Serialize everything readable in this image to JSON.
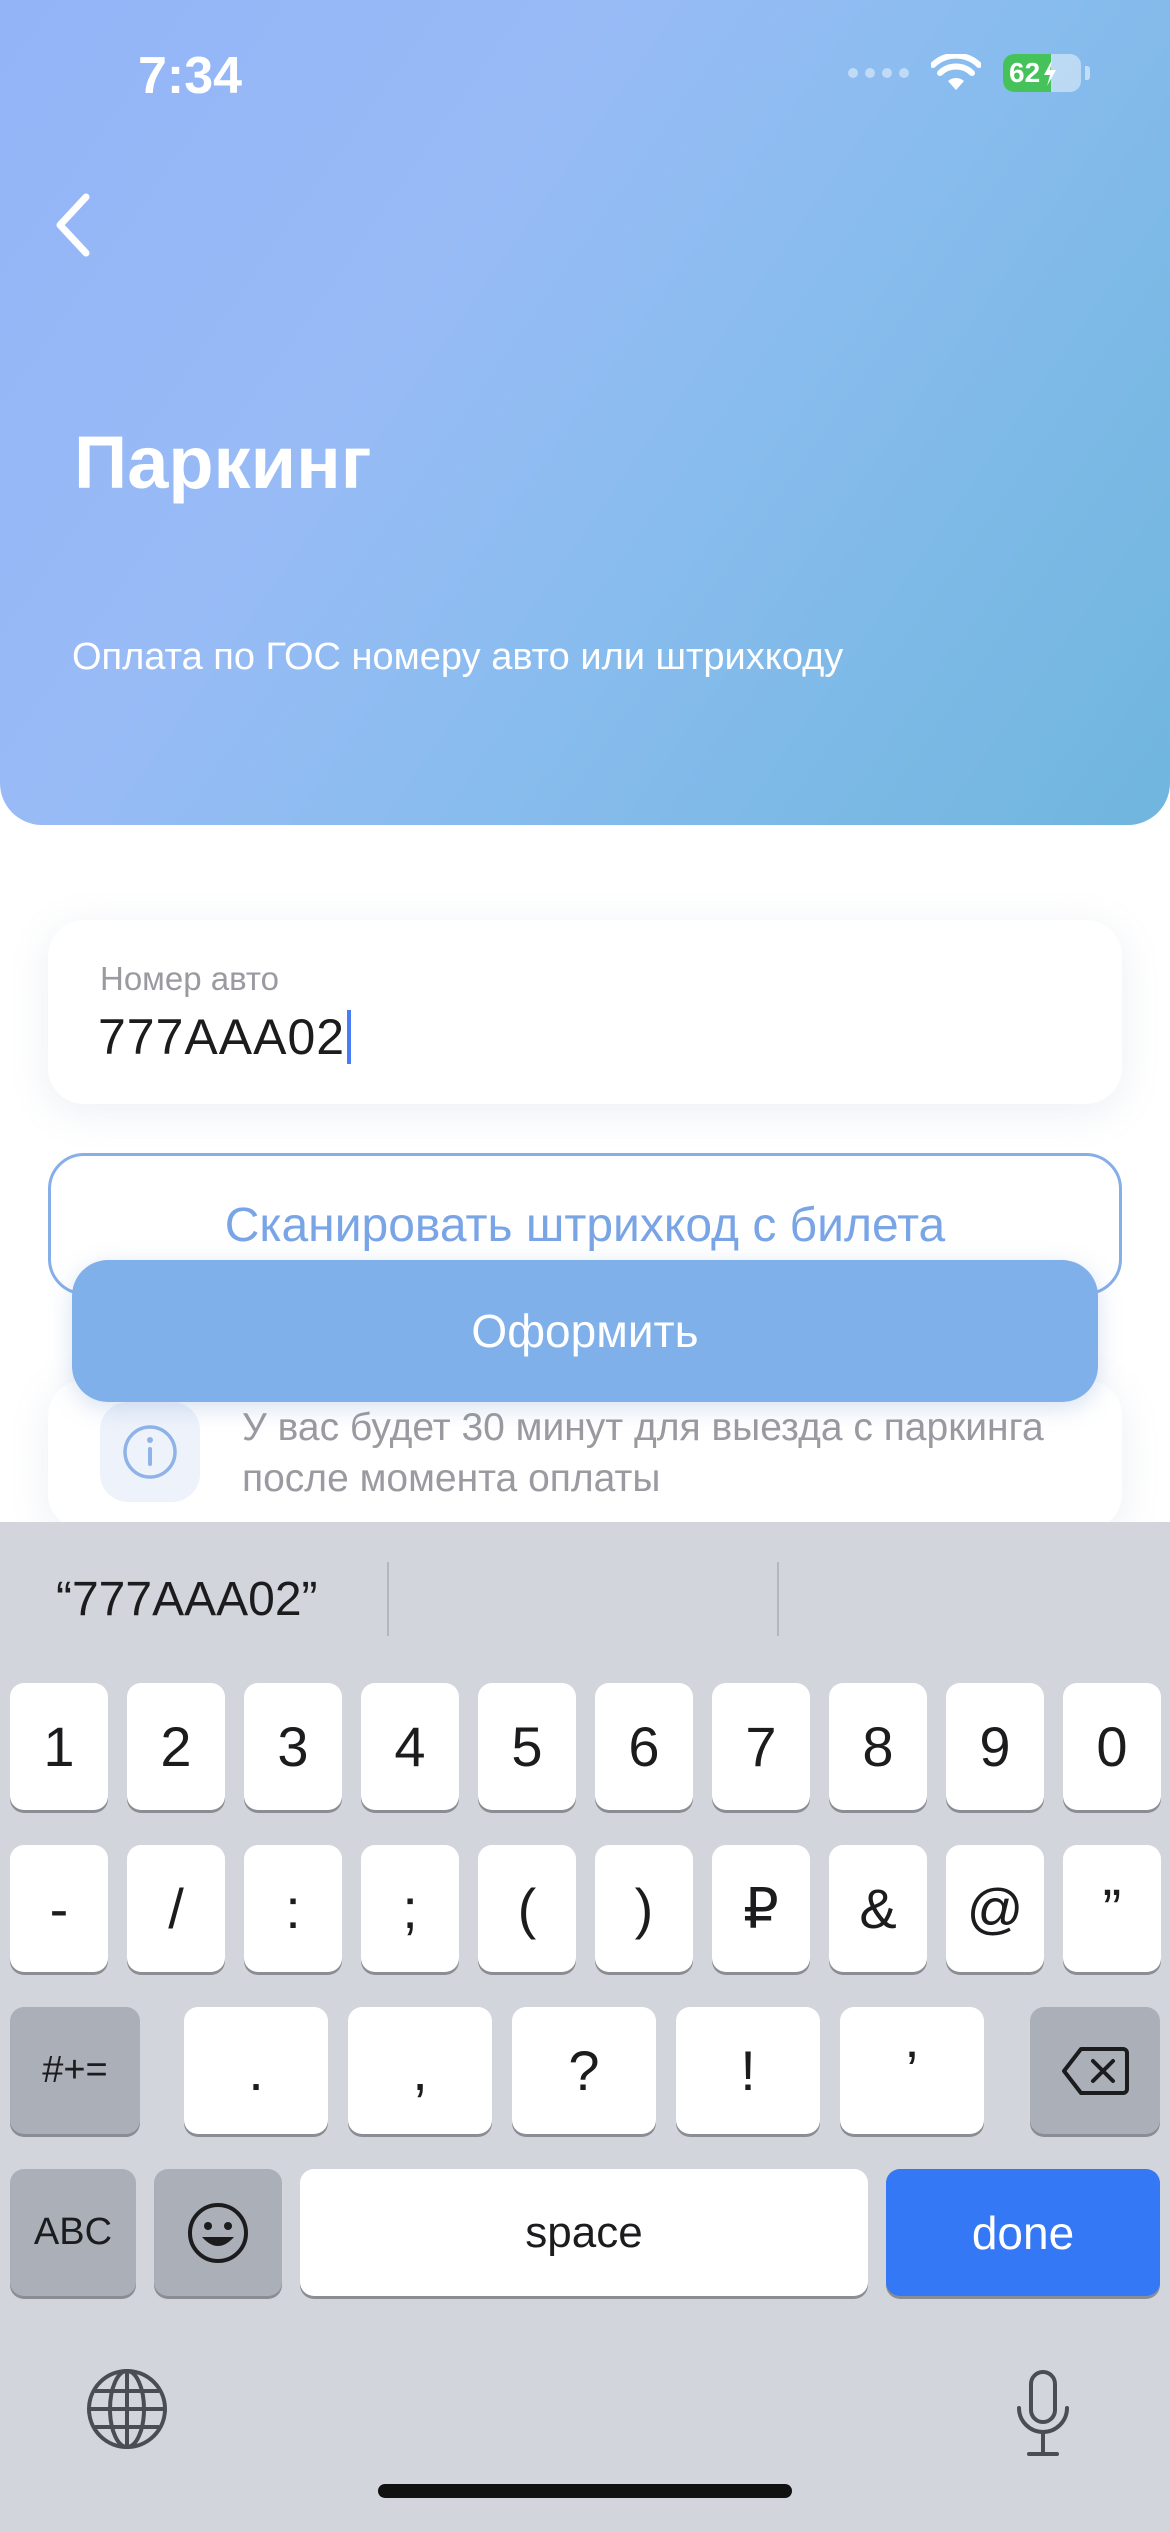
{
  "status_bar": {
    "time": "7:34",
    "battery": "62"
  },
  "header": {
    "title": "Паркинг",
    "subtitle": "Оплата по ГОС номеру авто или штрихкоду"
  },
  "form": {
    "car_number_label": "Номер авто",
    "car_number_value": "777AAA02",
    "scan_button_label": "Сканировать штрихкод с билета",
    "submit_button_label": "Оформить",
    "info_text": "У вас будет 30 минут для выезда с паркинга после момента оплаты"
  },
  "keyboard": {
    "suggestion": "“777AAA02”",
    "row1": [
      "1",
      "2",
      "3",
      "4",
      "5",
      "6",
      "7",
      "8",
      "9",
      "0"
    ],
    "row2": [
      "-",
      "/",
      ":",
      ";",
      "(",
      ")",
      "₽",
      "&",
      "@",
      "”"
    ],
    "row3": [
      ".",
      ",",
      "?",
      "!",
      "’"
    ],
    "symbols_key": "#+=",
    "abc_key": "ABC",
    "space_key": "space",
    "done_key": "done"
  },
  "colors": {
    "header_gradient_start": "#93b4f7",
    "header_gradient_end": "#6fb6dd",
    "primary_button": "#80b0ea",
    "done_key": "#3478f6"
  }
}
